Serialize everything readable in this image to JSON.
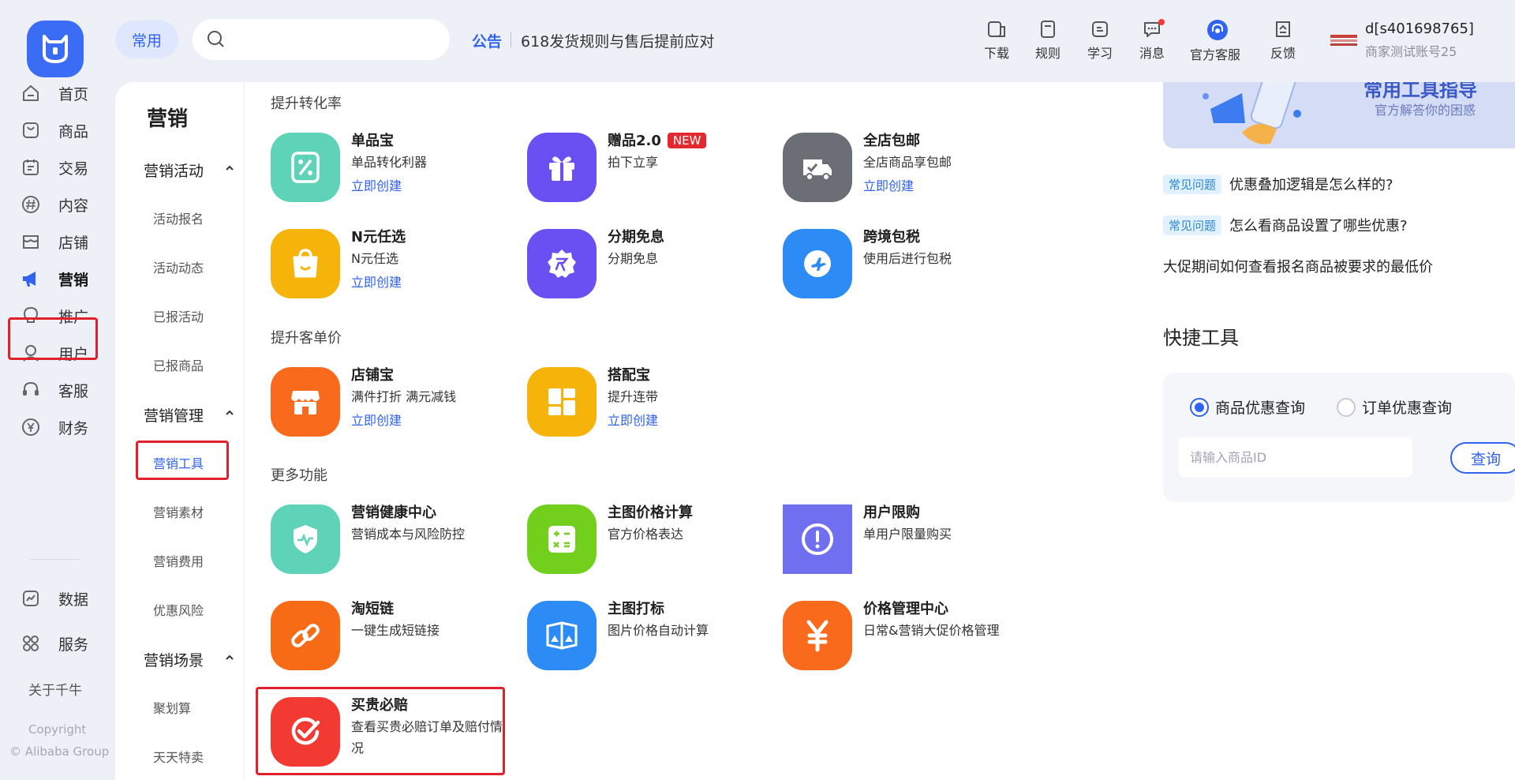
{
  "rail": {
    "items": [
      {
        "label": "首页",
        "icon": "home-icon"
      },
      {
        "label": "商品",
        "icon": "bag-icon"
      },
      {
        "label": "交易",
        "icon": "order-icon"
      },
      {
        "label": "内容",
        "icon": "hash-icon"
      },
      {
        "label": "店铺",
        "icon": "store-icon"
      },
      {
        "label": "营销",
        "icon": "megaphone-icon"
      },
      {
        "label": "推广",
        "icon": "bulb-icon"
      },
      {
        "label": "用户",
        "icon": "user-icon"
      },
      {
        "label": "客服",
        "icon": "headset-icon"
      },
      {
        "label": "财务",
        "icon": "yuan-icon"
      },
      {
        "label": "数据",
        "icon": "chart-icon"
      },
      {
        "label": "服务",
        "icon": "grid-icon"
      }
    ],
    "active": "营销",
    "about": "关于千牛",
    "copyright_line1": "Copyright",
    "copyright_line2": "© Alibaba Group"
  },
  "header": {
    "common_label": "常用",
    "search_placeholder": "",
    "notice_label": "公告",
    "notice_text": "618发货规则与售后提前应对",
    "tools": [
      {
        "label": "下载",
        "icon": "download-icon"
      },
      {
        "label": "规则",
        "icon": "rules-icon"
      },
      {
        "label": "学习",
        "icon": "learn-icon"
      },
      {
        "label": "消息",
        "icon": "message-icon"
      },
      {
        "label": "官方客服",
        "icon": "support-icon"
      },
      {
        "label": "反馈",
        "icon": "feedback-icon"
      }
    ],
    "account_name": "d[s401698765]",
    "account_sub": "商家测试账号25"
  },
  "subnav": {
    "title": "营销",
    "groups": [
      {
        "label": "营销活动",
        "items": [
          "活动报名",
          "活动动态",
          "已报活动",
          "已报商品"
        ]
      },
      {
        "label": "营销管理",
        "items": [
          "营销工具",
          "营销素材",
          "营销费用",
          "优惠风险"
        ]
      },
      {
        "label": "营销场景",
        "items": [
          "聚划算",
          "天天特卖"
        ]
      }
    ],
    "active_item": "营销工具"
  },
  "sections": [
    {
      "title": "提升转化率",
      "cards": [
        {
          "title": "单品宝",
          "desc": "单品转化利器",
          "link": "立即创建",
          "color": "#5fd3b8",
          "icon": "percent-tag-icon"
        },
        {
          "title": "赠品2.0",
          "badge": "NEW",
          "desc": "拍下立享",
          "color": "#6a4ff2",
          "icon": "gift-icon"
        },
        {
          "title": "全店包邮",
          "desc": "全店商品享包邮",
          "link": "立即创建",
          "color": "#6b6e75",
          "icon": "truck-icon"
        },
        {
          "title": "N元任选",
          "desc": "N元任选",
          "link": "立即创建",
          "color": "#f6b40a",
          "icon": "shopping-bag-icon"
        },
        {
          "title": "分期免息",
          "desc": "分期免息",
          "color": "#6a4ff2",
          "icon": "installment-icon"
        },
        {
          "title": "跨境包税",
          "desc": "使用后进行包税",
          "color": "#2d8bf6",
          "icon": "plane-icon"
        }
      ]
    },
    {
      "title": "提升客单价",
      "cards": [
        {
          "title": "店铺宝",
          "desc": "满件打折 满元减钱",
          "link": "立即创建",
          "color": "#fa6a1c",
          "icon": "shop-awning-icon"
        },
        {
          "title": "搭配宝",
          "desc": "提升连带",
          "link": "立即创建",
          "color": "#f6b40a",
          "icon": "layout-blocks-icon"
        }
      ]
    },
    {
      "title": "更多功能",
      "cards": [
        {
          "title": "营销健康中心",
          "desc": "营销成本与风险防控",
          "color": "#5fd3b8",
          "icon": "shield-pulse-icon"
        },
        {
          "title": "主图价格计算",
          "desc": "官方价格表达",
          "color": "#72cf1c",
          "icon": "calculator-icon"
        },
        {
          "title": "用户限购",
          "desc": "单用户限量购买",
          "color": "#6f6ff0",
          "icon": "exclamation-icon"
        },
        {
          "title": "淘短链",
          "desc": "一键生成短链接",
          "color": "#f76b16",
          "icon": "link-icon"
        },
        {
          "title": "主图打标",
          "desc": "图片价格自动计算",
          "color": "#2d8bf6",
          "icon": "image-tag-icon"
        },
        {
          "title": "价格管理中心",
          "desc": "日常&营销大促价格管理",
          "color": "#fa6a1c",
          "icon": "yuan-price-icon"
        },
        {
          "title": "买贵必赔",
          "desc": "查看买贵必赔订单及赔付情况",
          "color": "#f23a32",
          "icon": "check-badge-icon"
        }
      ]
    }
  ],
  "right": {
    "banner_title": "常用工具指导",
    "banner_sub": "官方解答你的困惑",
    "faqs": [
      {
        "tag": "常见问题",
        "text": "优惠叠加逻辑是怎么样的?"
      },
      {
        "tag": "常见问题",
        "text": "怎么看商品设置了哪些优惠?"
      },
      {
        "tag": "",
        "text": "大促期间如何查看报名商品被要求的最低价"
      }
    ],
    "quick_title": "快捷工具",
    "radio_options": [
      "商品优惠查询",
      "订单优惠查询"
    ],
    "radio_selected": "商品优惠查询",
    "input_placeholder": "请输入商品ID",
    "query_button": "查询"
  }
}
